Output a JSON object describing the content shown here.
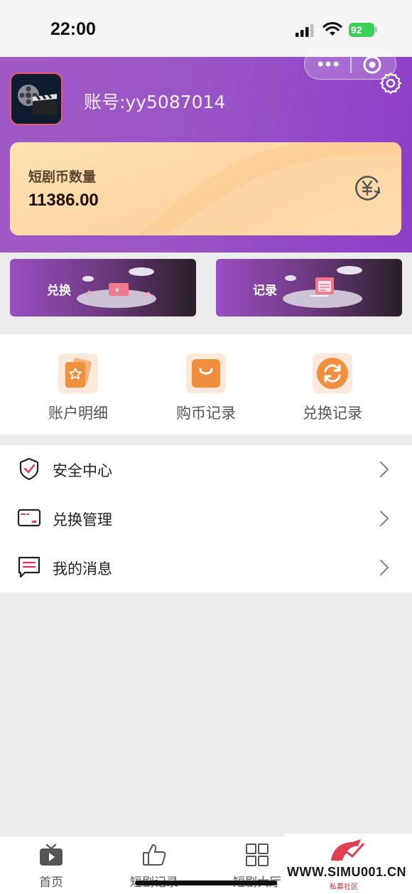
{
  "status_bar": {
    "time": "22:00",
    "battery": "92"
  },
  "profile": {
    "account_label": "账号:",
    "account_id": "yy5087014"
  },
  "balance_card": {
    "label": "短剧币数量",
    "amount": "11386.00"
  },
  "banners": [
    {
      "label": "兑换"
    },
    {
      "label": "记录"
    }
  ],
  "quick_actions": [
    {
      "label": "账户明细",
      "icon": "wallet-card-icon"
    },
    {
      "label": "购币记录",
      "icon": "shopping-bag-icon"
    },
    {
      "label": "兑换记录",
      "icon": "exchange-cycle-icon"
    }
  ],
  "menu": [
    {
      "label": "安全中心",
      "icon": "shield-check-icon"
    },
    {
      "label": "兑换管理",
      "icon": "card-icon"
    },
    {
      "label": "我的消息",
      "icon": "message-icon"
    }
  ],
  "tabbar": [
    {
      "label": "首页",
      "icon": "play-tv-icon"
    },
    {
      "label": "短剧记录",
      "icon": "thumbs-up-icon"
    },
    {
      "label": "短剧大厅",
      "icon": "grid-icon"
    }
  ],
  "watermark": {
    "url": "WWW.SIMU001.CN",
    "sub": "私募社区"
  },
  "colors": {
    "header": "#9b56c6",
    "card": "#fdd5a2",
    "accent_orange": "#f0903e",
    "tab_text": "#555555"
  }
}
